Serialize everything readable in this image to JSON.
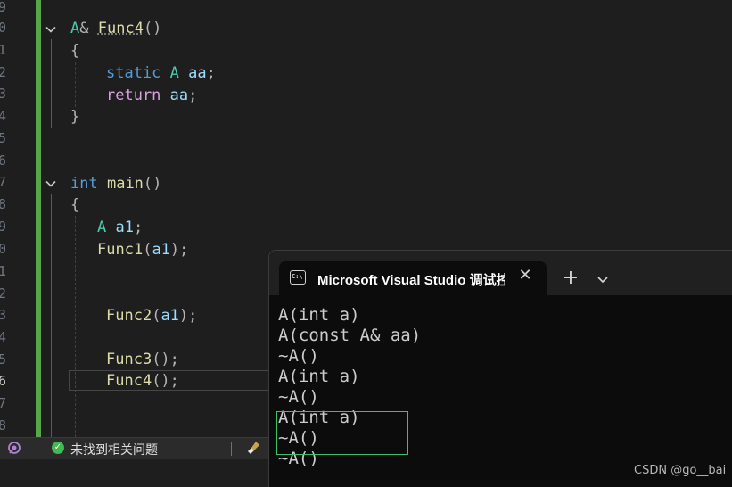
{
  "editor": {
    "line_numbers": [
      "9",
      "0",
      "1",
      "2",
      "3",
      "4",
      "5",
      "6",
      "7",
      "8",
      "9",
      "0",
      "1",
      "2",
      "3",
      "4",
      "5",
      "6",
      "7",
      "8"
    ],
    "active_line_number": "6",
    "lines": {
      "func4_return_type": "A",
      "func4_amp": "&",
      "func4_name": "Func4",
      "func4_parens": "()",
      "open_brace_1": "{",
      "static_kw": "static",
      "static_type": "A",
      "static_var": "aa",
      "static_semi": ";",
      "return_kw": "return",
      "return_var": "aa",
      "return_semi": ";",
      "close_brace_1": "}",
      "main_type": "int",
      "main_name": "main",
      "main_parens": "()",
      "open_brace_2": "{",
      "decl_type": "A",
      "decl_var": "a1",
      "decl_semi": ";",
      "call1_name": "Func1",
      "call1_args_open": "(",
      "call1_arg": "a1",
      "call1_args_close": ");",
      "call2_name": "Func2",
      "call2_args_open": "(",
      "call2_arg": "a1",
      "call2_args_close": ");",
      "call3_name": "Func3",
      "call3_rest": "();",
      "call4_name": "Func4",
      "call4_rest": "();"
    }
  },
  "statusbar": {
    "issues_text": "未找到相关问题",
    "check_glyph": "✓"
  },
  "terminal": {
    "tab_icon_text": "C:\\",
    "tab_title": "Microsoft Visual Studio 调试控",
    "close_glyph": "✕",
    "new_tab_glyph": "+",
    "output": [
      "A(int a)",
      "A(const A& aa)",
      "~A()",
      "A(int a)",
      "~A()",
      "A(int a)",
      "~A()",
      "~A()"
    ]
  },
  "watermark": "CSDN @go__bai",
  "colors": {
    "change_bar": "#57a64a",
    "keyword": "#569cd6",
    "control_keyword": "#d8a0df",
    "type": "#4ec9b0",
    "function": "#dcdcaa",
    "variable": "#9cdcfe",
    "selection_box": "#3dbf6e"
  }
}
